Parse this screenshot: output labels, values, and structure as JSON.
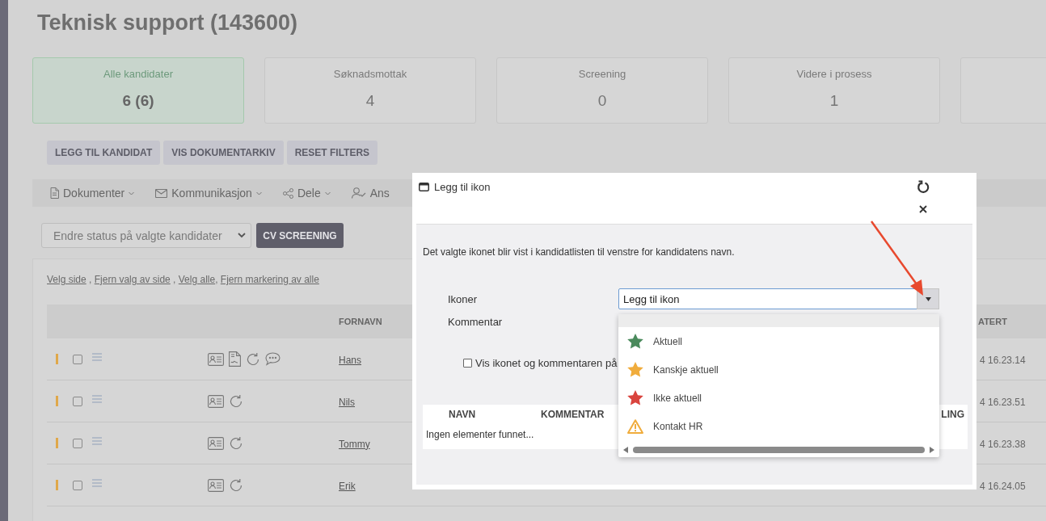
{
  "page_title": "Teknisk support (143600)",
  "status_cards": [
    {
      "label": "Alle kandidater",
      "count": "6 (6)",
      "selected": true
    },
    {
      "label": "Søknadsmottak",
      "count": "4",
      "selected": false
    },
    {
      "label": "Screening",
      "count": "0",
      "selected": false
    },
    {
      "label": "Videre i prosess",
      "count": "1",
      "selected": false
    }
  ],
  "action_buttons": [
    "LEGG TIL KANDIDAT",
    "VIS DOKUMENTARKIV",
    "RESET FILTERS"
  ],
  "toolbar": [
    {
      "label": "Dokumenter",
      "kind": "document",
      "dropdown": true
    },
    {
      "label": "Kommunikasjon",
      "kind": "mail",
      "dropdown": true
    },
    {
      "label": "Dele",
      "kind": "share",
      "dropdown": true
    },
    {
      "label": "Ans",
      "kind": "person",
      "dropdown": false
    }
  ],
  "status_select": {
    "value": "Endre status på valgte kandidater"
  },
  "screening_button": "CV SCREENING",
  "selection_links": [
    {
      "label": "Velg side",
      "separator": " , "
    },
    {
      "label": "Fjern valg av side",
      "separator": " , "
    },
    {
      "label": "Velg alle",
      "separator": ", "
    },
    {
      "label": "Fjern markering av alle"
    }
  ],
  "table": {
    "columns": [
      "FORNAVN",
      "ATERT"
    ],
    "rows": [
      {
        "checked": false,
        "icons": [
          {
            "kind": "card"
          },
          {
            "kind": "document"
          },
          {
            "kind": "refresh"
          },
          {
            "kind": "chat"
          }
        ],
        "first_name": "Hans",
        "updated": "4 16.23.14"
      },
      {
        "checked": false,
        "icons": [
          {
            "kind": "card"
          },
          {
            "kind": "refresh"
          }
        ],
        "first_name": "Nils",
        "updated": "4 16.23.51"
      },
      {
        "checked": false,
        "icons": [
          {
            "kind": "card"
          },
          {
            "kind": "refresh"
          }
        ],
        "first_name": "Tommy",
        "updated": "4 16.23.38"
      },
      {
        "checked": false,
        "icons": [
          {
            "kind": "card"
          },
          {
            "kind": "refresh"
          }
        ],
        "first_name": "Erik",
        "updated": "4 16.24.05"
      }
    ]
  },
  "modal": {
    "title": "Legg til ikon",
    "description": "Det valgte ikonet blir vist i kandidatlisten til venstre for kandidatens navn.",
    "icon_label": "Ikoner",
    "icon_value": "Legg til ikon",
    "expanded": true,
    "comment_label": "Kommentar",
    "checkbox": {
      "label": "Vis ikonet og kommentaren på",
      "checked": false
    },
    "options": [
      {
        "label": "Aktuell",
        "kind": "star",
        "color": "#4a8a5c"
      },
      {
        "label": "Kanskje aktuell",
        "kind": "star",
        "color": "#f0ac3c"
      },
      {
        "label": "Ikke aktuell",
        "kind": "star",
        "color": "#d9443e"
      },
      {
        "label": "Kontakt HR",
        "kind": "warning",
        "color": "#f0ac3c"
      }
    ],
    "result_columns": [
      "NAVN",
      "KOMMENTAR",
      "LING"
    ],
    "empty_text": "Ingen elementer funnet..."
  }
}
